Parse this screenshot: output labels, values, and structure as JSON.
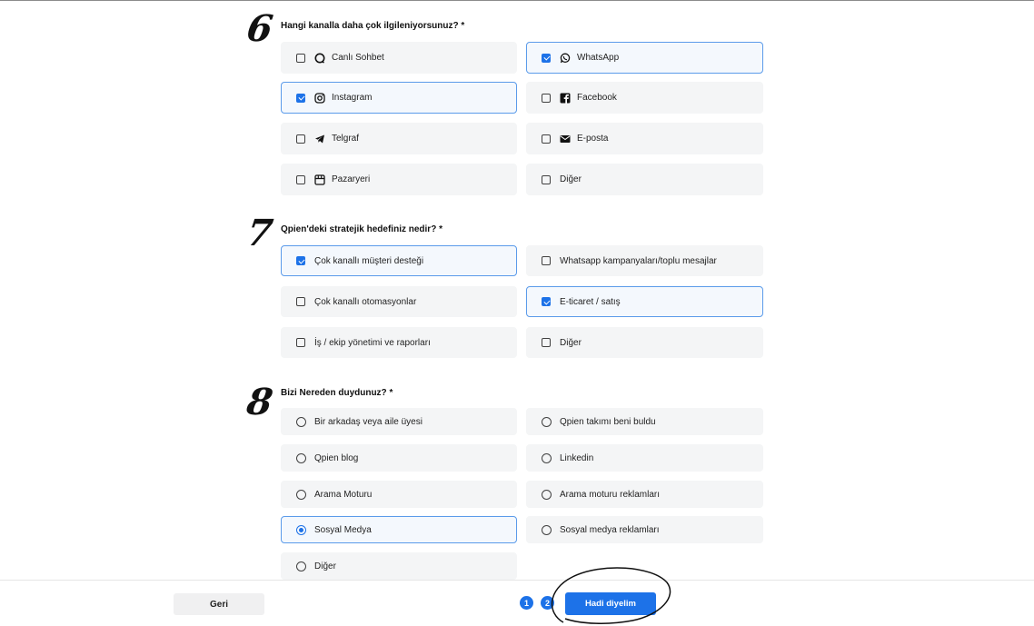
{
  "question6": {
    "number": "6",
    "title": "Hangi kanalla daha çok ilgileniyorsunuz? *",
    "options": [
      {
        "label": "Canlı Sohbet",
        "icon": "chat-bubble-icon",
        "checked": false
      },
      {
        "label": "WhatsApp",
        "icon": "whatsapp-icon",
        "checked": true
      },
      {
        "label": "Instagram",
        "icon": "instagram-icon",
        "checked": true
      },
      {
        "label": "Facebook",
        "icon": "facebook-icon",
        "checked": false
      },
      {
        "label": "Telgraf",
        "icon": "telegram-icon",
        "checked": false
      },
      {
        "label": "E-posta",
        "icon": "envelope-icon",
        "checked": false
      },
      {
        "label": "Pazaryeri",
        "icon": "storefront-icon",
        "checked": false
      },
      {
        "label": "Diğer",
        "icon": "",
        "checked": false
      }
    ]
  },
  "question7": {
    "number": "7",
    "title": "Qpien'deki stratejik hedefiniz nedir? *",
    "options": [
      {
        "label": "Çok kanallı müşteri desteği",
        "checked": true
      },
      {
        "label": "Whatsapp kampanyaları/toplu mesajlar",
        "checked": false
      },
      {
        "label": "Çok kanallı otomasyonlar",
        "checked": false
      },
      {
        "label": "E-ticaret / satış",
        "checked": true
      },
      {
        "label": "İş / ekip yönetimi ve raporları",
        "checked": false
      },
      {
        "label": "Diğer",
        "checked": false
      }
    ]
  },
  "question8": {
    "number": "8",
    "title": "Bizi Nereden duydunuz? *",
    "options": [
      {
        "label": "Bir arkadaş veya aile üyesi",
        "selected": false
      },
      {
        "label": "Qpien takımı beni buldu",
        "selected": false
      },
      {
        "label": "Qpien blog",
        "selected": false
      },
      {
        "label": "Linkedin",
        "selected": false
      },
      {
        "label": "Arama Moturu",
        "selected": false
      },
      {
        "label": "Arama moturu reklamları",
        "selected": false
      },
      {
        "label": "Sosyal Medya",
        "selected": true
      },
      {
        "label": "Sosyal medya reklamları",
        "selected": false
      },
      {
        "label": "Diğer",
        "selected": false
      }
    ]
  },
  "footer": {
    "back_label": "Geri",
    "page_1": "1",
    "page_2": "2",
    "next_label": "Hadi diyelim"
  },
  "colors": {
    "accent": "#1d72e8",
    "option_bg": "#f4f5f6",
    "selected_border": "#5b9bea"
  }
}
